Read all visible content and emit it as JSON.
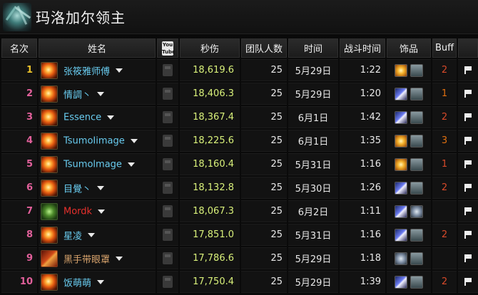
{
  "header": {
    "title": "玛洛加尔领主",
    "boss_icon": "boss-portrait-icon"
  },
  "columns": {
    "rank": "名次",
    "name": "姓名",
    "youtube": "You Tube",
    "dps": "秒伤",
    "raid_size": "团队人数",
    "date": "时间",
    "fight_time": "战斗时间",
    "trinkets": "饰品",
    "buff": "Buff"
  },
  "rows": [
    {
      "rank": "1",
      "rank_color": "gold",
      "spec": "fire",
      "name": "张筱雅师傅",
      "name_class": "mage",
      "dps": "18,619.6",
      "raid_size": "25",
      "date": "5月29日",
      "fight_time": "1:22",
      "trinkets": [
        "sun",
        "mask"
      ],
      "buff": "2",
      "buff_color": "red"
    },
    {
      "rank": "2",
      "rank_color": "pink",
      "spec": "fire",
      "name": "情調丶",
      "name_class": "mage",
      "dps": "18,406.3",
      "raid_size": "25",
      "date": "5月29日",
      "fight_time": "1:20",
      "trinkets": [
        "blade",
        "mask"
      ],
      "buff": "1",
      "buff_color": "orange"
    },
    {
      "rank": "3",
      "rank_color": "pink",
      "spec": "fire",
      "name": "Essence",
      "name_class": "mage",
      "dps": "18,367.4",
      "raid_size": "25",
      "date": "6月1日",
      "fight_time": "1:42",
      "trinkets": [
        "blade",
        "mask"
      ],
      "buff": "2",
      "buff_color": "red"
    },
    {
      "rank": "4",
      "rank_color": "pink",
      "spec": "fire",
      "name": "TsumoIimage",
      "name_class": "mage",
      "dps": "18,225.6",
      "raid_size": "25",
      "date": "6月1日",
      "fight_time": "1:35",
      "trinkets": [
        "sun",
        "mask"
      ],
      "buff": "3",
      "buff_color": "orange"
    },
    {
      "rank": "5",
      "rank_color": "pink",
      "spec": "fire",
      "name": "Tsumolmage",
      "name_class": "mage",
      "dps": "18,160.4",
      "raid_size": "25",
      "date": "5月31日",
      "fight_time": "1:16",
      "trinkets": [
        "sun",
        "mask"
      ],
      "buff": "1",
      "buff_color": "red"
    },
    {
      "rank": "6",
      "rank_color": "pink",
      "spec": "fire",
      "name": "目覺丶",
      "name_class": "mage",
      "dps": "18,132.8",
      "raid_size": "25",
      "date": "5月30日",
      "fight_time": "1:26",
      "trinkets": [
        "blade",
        "mask"
      ],
      "buff": "2",
      "buff_color": "red"
    },
    {
      "rank": "7",
      "rank_color": "pink",
      "spec": "aff",
      "name": "Mordk",
      "name_class": "lock",
      "dps": "18,067.3",
      "raid_size": "25",
      "date": "6月2日",
      "fight_time": "1:11",
      "trinkets": [
        "blade",
        "ghost"
      ],
      "buff": "",
      "buff_color": "red"
    },
    {
      "rank": "8",
      "rank_color": "pink",
      "spec": "fire",
      "name": "星凌",
      "name_class": "mage",
      "dps": "17,851.0",
      "raid_size": "25",
      "date": "5月31日",
      "fight_time": "1:16",
      "trinkets": [
        "blade",
        "mask"
      ],
      "buff": "2",
      "buff_color": "red"
    },
    {
      "rank": "9",
      "rank_color": "pink",
      "spec": "fury",
      "name": "黑手带眼罩",
      "name_class": "warrior",
      "dps": "17,786.6",
      "raid_size": "25",
      "date": "5月29日",
      "fight_time": "1:18",
      "trinkets": [
        "ghost",
        "mask"
      ],
      "buff": "",
      "buff_color": "red"
    },
    {
      "rank": "10",
      "rank_color": "pink",
      "spec": "fire",
      "name": "饭萌萌",
      "name_class": "mage",
      "dps": "17,750.4",
      "raid_size": "25",
      "date": "5月29日",
      "fight_time": "1:39",
      "trinkets": [
        "blade",
        "mask"
      ],
      "buff": "2",
      "buff_color": "red"
    }
  ]
}
